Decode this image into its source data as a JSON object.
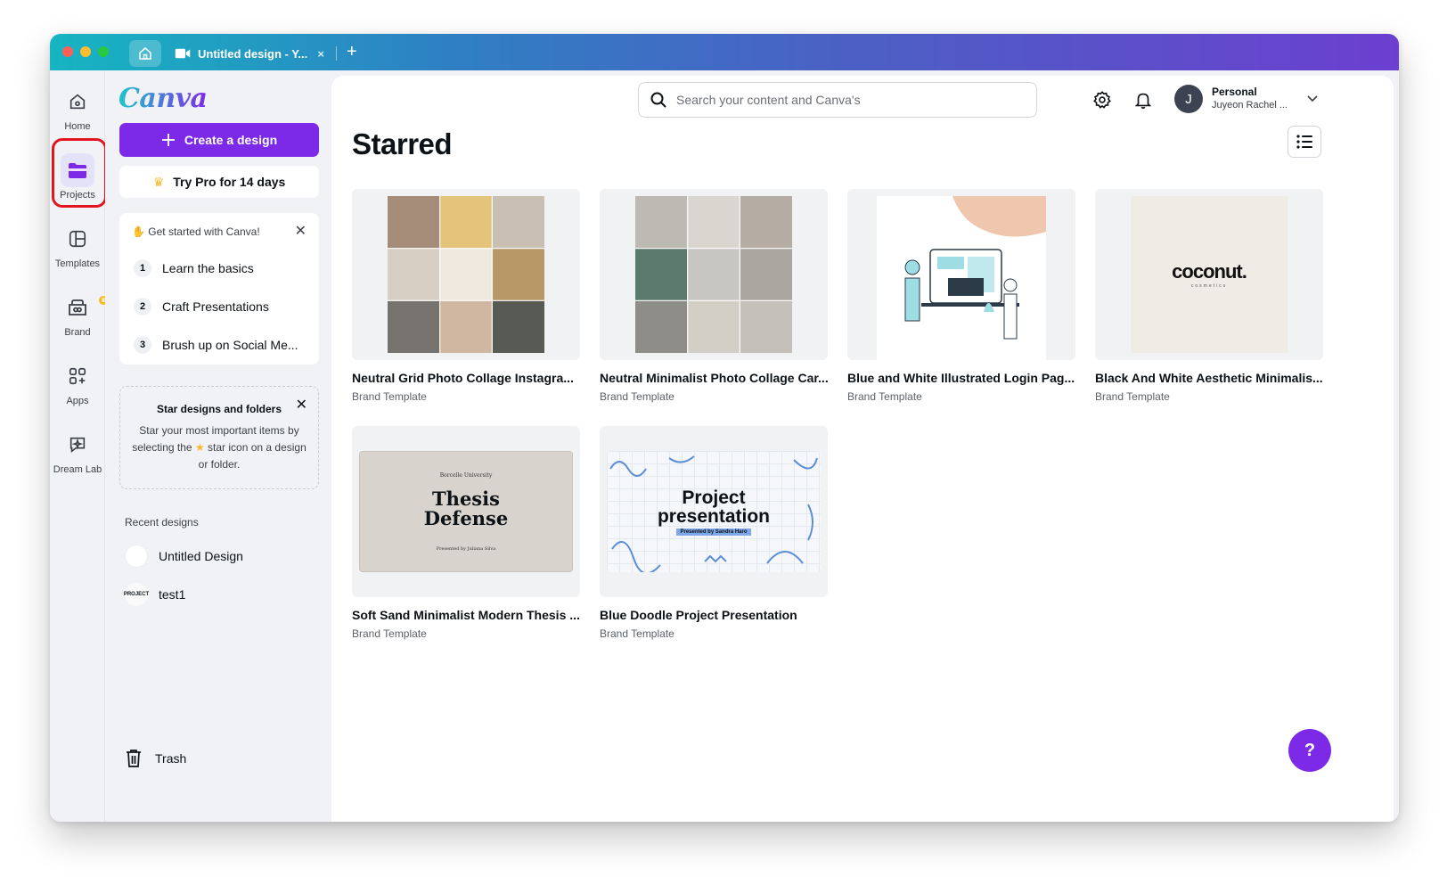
{
  "titlebar": {
    "tab_title": "Untitled design - Y...",
    "tab_close": "×",
    "new_tab": "+"
  },
  "rail": {
    "items": [
      {
        "label": "Home"
      },
      {
        "label": "Projects"
      },
      {
        "label": "Templates"
      },
      {
        "label": "Brand"
      },
      {
        "label": "Apps"
      },
      {
        "label": "Dream Lab"
      }
    ]
  },
  "panel": {
    "logo": "Canva",
    "create_label": "Create a design",
    "pro_label": "Try Pro for 14 days",
    "get_started": {
      "title": "Get started with Canva!",
      "steps": [
        {
          "num": "1",
          "label": "Learn the basics"
        },
        {
          "num": "2",
          "label": "Craft Presentations"
        },
        {
          "num": "3",
          "label": "Brush up on Social Me..."
        }
      ]
    },
    "star_card": {
      "title": "Star designs and folders",
      "text_before": "Star your most important items by selecting the",
      "text_after": "star icon on a design or folder."
    },
    "recent_label": "Recent designs",
    "recent": [
      {
        "label": "Untitled Design"
      },
      {
        "label": "test1",
        "thumb_text": "PROJECT"
      }
    ],
    "trash_label": "Trash"
  },
  "header": {
    "search_placeholder": "Search your content and Canva's",
    "account_name": "Personal",
    "account_sub": "Juyeon Rachel ...",
    "avatar_initial": "J"
  },
  "main": {
    "title": "Starred",
    "cards": [
      {
        "title": "Neutral Grid Photo Collage Instagra...",
        "sub": "Brand Template"
      },
      {
        "title": "Neutral Minimalist Photo Collage Car...",
        "sub": "Brand Template"
      },
      {
        "title": "Blue and White Illustrated Login Pag...",
        "sub": "Brand Template"
      },
      {
        "title": "Black And White Aesthetic Minimalis...",
        "sub": "Brand Template",
        "thumb_logo": "coconut.",
        "thumb_tag": "cosmetics"
      },
      {
        "title": "Soft Sand Minimalist Modern Thesis ...",
        "sub": "Brand Template",
        "thumb_top": "Borcelle University",
        "thumb_line1": "Thesis",
        "thumb_line2": "Defense",
        "thumb_bottom": "Presented by Juliana Silva"
      },
      {
        "title": "Blue Doodle Project Presentation",
        "sub": "Brand Template",
        "thumb_line1": "Project",
        "thumb_line2": "presentation",
        "thumb_tag": "Presented by Sandra Haro"
      }
    ],
    "help": "?"
  },
  "colors": {
    "accent": "#7d2ae8",
    "highlight": "#e1141f"
  }
}
